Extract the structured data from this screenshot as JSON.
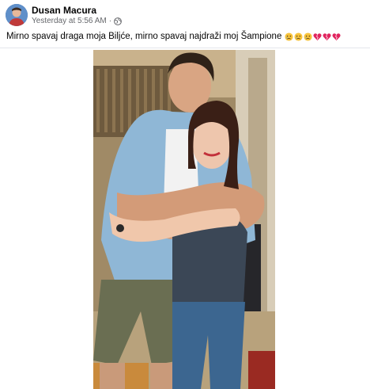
{
  "post": {
    "author_name": "Dusan Macura",
    "timestamp": "Yesterday at 5:56 AM",
    "separator": "·",
    "privacy_icon": "globe-icon",
    "caption_text": "Mirno spavaj draga moja Biljće, mirno spavaj najdraži moj Šampione",
    "caption_emojis": [
      "sad-face-icon",
      "sad-face-icon",
      "sad-face-icon",
      "broken-heart-icon",
      "broken-heart-icon",
      "broken-heart-icon"
    ]
  },
  "colors": {
    "name_text": "#050505",
    "meta_text": "#65676b",
    "divider": "#e4e6eb",
    "heart_red": "#e0245e",
    "emoji_yellow": "#f7c33b"
  }
}
